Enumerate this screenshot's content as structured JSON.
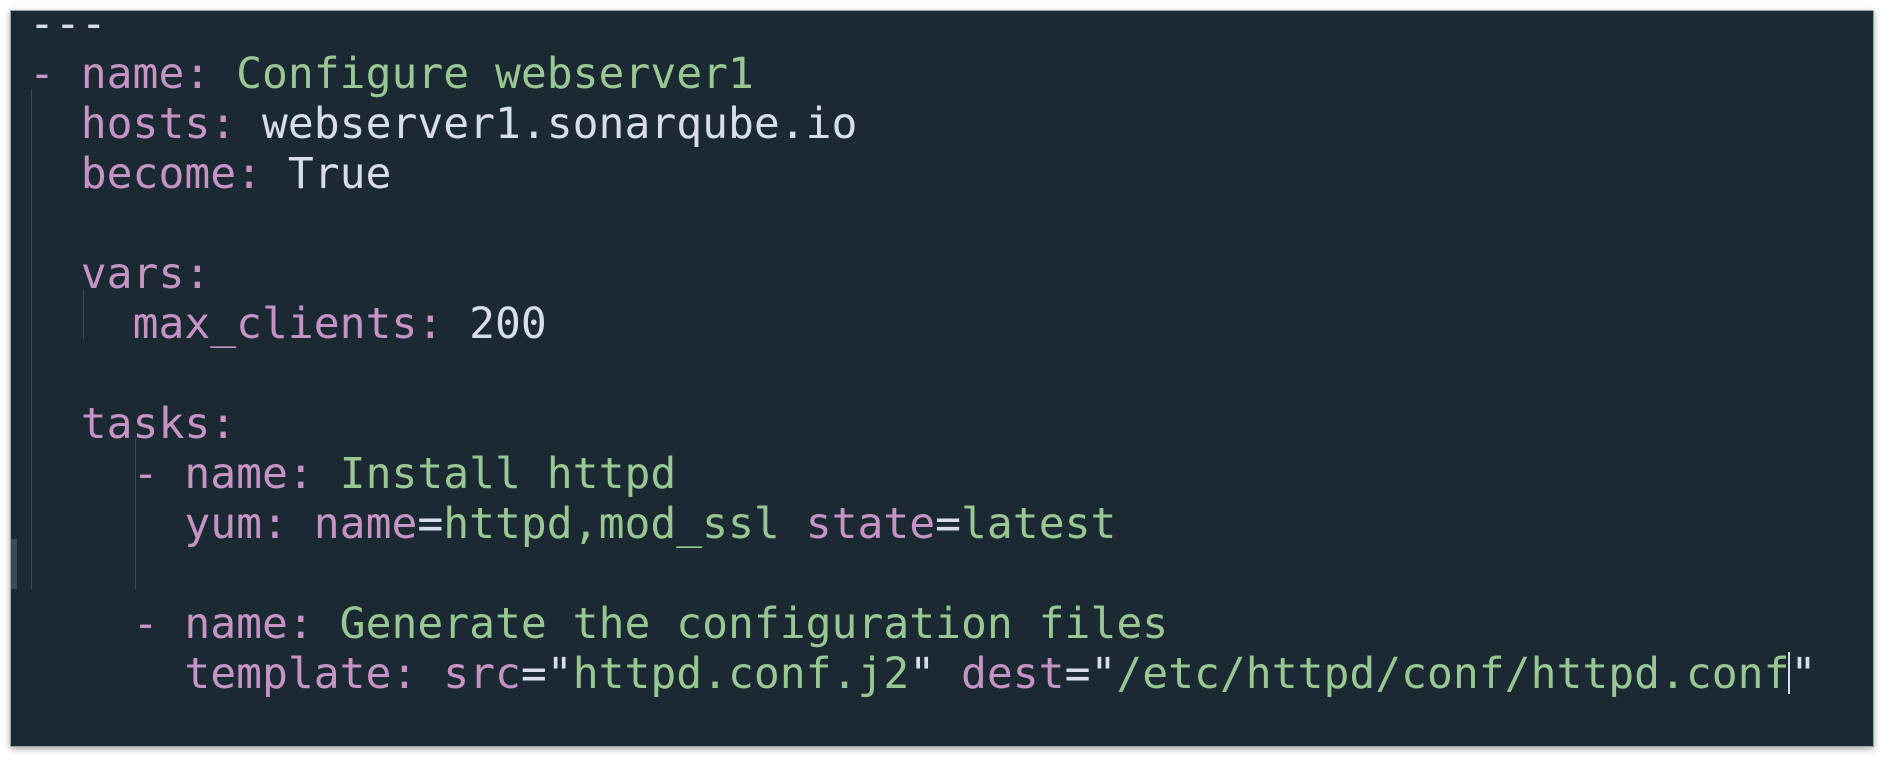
{
  "editor": {
    "lines": [
      {
        "indent": "",
        "parts": [
          {
            "t": "---",
            "c": "p"
          }
        ]
      },
      {
        "indent": "",
        "parts": [
          {
            "t": "- ",
            "c": "k"
          },
          {
            "t": "name:",
            "c": "k"
          },
          {
            "t": " Configure webserver1",
            "c": "s"
          }
        ]
      },
      {
        "indent": "  ",
        "parts": [
          {
            "t": "hosts:",
            "c": "k"
          },
          {
            "t": " webserver1.sonarqube.io",
            "c": "p"
          }
        ]
      },
      {
        "indent": "  ",
        "parts": [
          {
            "t": "become:",
            "c": "k"
          },
          {
            "t": " True",
            "c": "p"
          }
        ]
      },
      {
        "indent": "",
        "parts": []
      },
      {
        "indent": "  ",
        "parts": [
          {
            "t": "vars:",
            "c": "k"
          }
        ]
      },
      {
        "indent": "    ",
        "parts": [
          {
            "t": "max_clients:",
            "c": "k"
          },
          {
            "t": " 200",
            "c": "p"
          }
        ]
      },
      {
        "indent": "",
        "parts": []
      },
      {
        "indent": "  ",
        "parts": [
          {
            "t": "tasks:",
            "c": "k"
          }
        ]
      },
      {
        "indent": "    ",
        "parts": [
          {
            "t": "- ",
            "c": "k"
          },
          {
            "t": "name:",
            "c": "k"
          },
          {
            "t": " Install httpd",
            "c": "s"
          }
        ]
      },
      {
        "indent": "      ",
        "parts": [
          {
            "t": "yum:",
            "c": "k"
          },
          {
            "t": " ",
            "c": "p"
          },
          {
            "t": "name",
            "c": "k"
          },
          {
            "t": "=",
            "c": "p"
          },
          {
            "t": "httpd,mod_ssl",
            "c": "s"
          },
          {
            "t": " ",
            "c": "p"
          },
          {
            "t": "state",
            "c": "k"
          },
          {
            "t": "=",
            "c": "p"
          },
          {
            "t": "latest",
            "c": "s"
          }
        ]
      },
      {
        "indent": "",
        "parts": []
      },
      {
        "indent": "    ",
        "parts": [
          {
            "t": "- ",
            "c": "k"
          },
          {
            "t": "name:",
            "c": "k"
          },
          {
            "t": " Generate the configuration files",
            "c": "s"
          }
        ]
      },
      {
        "indent": "      ",
        "parts": [
          {
            "t": "template:",
            "c": "k"
          },
          {
            "t": " ",
            "c": "p"
          },
          {
            "t": "src",
            "c": "k"
          },
          {
            "t": "=\"",
            "c": "p"
          },
          {
            "t": "httpd.conf.j2",
            "c": "s"
          },
          {
            "t": "\" ",
            "c": "p"
          },
          {
            "t": "dest",
            "c": "k"
          },
          {
            "t": "=\"",
            "c": "p"
          },
          {
            "t": "/etc/httpd/conf/httpd.conf",
            "c": "s"
          },
          {
            "t": "CURSOR",
            "c": "cursor"
          },
          {
            "t": "\"",
            "c": "p"
          }
        ]
      },
      {
        "indent": "",
        "parts": []
      }
    ]
  }
}
